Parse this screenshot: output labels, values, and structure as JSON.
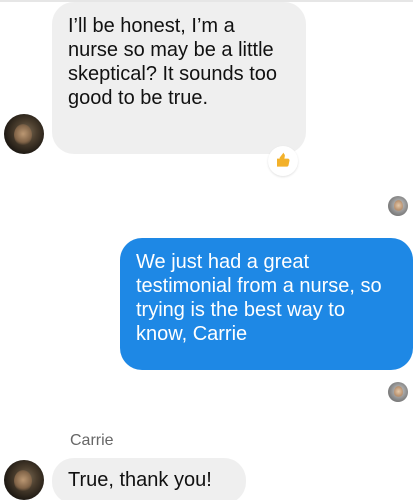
{
  "conversation": {
    "messages": [
      {
        "direction": "incoming",
        "text": "I’ll be honest, I’m a nurse so may be a little skeptical? It sounds too good to be true.",
        "reaction": "thumbs-up-icon"
      },
      {
        "direction": "outgoing",
        "text": "We just had a great testimonial from a nurse, so trying is the best way to know, Carrie"
      },
      {
        "direction": "incoming",
        "sender": "Carrie",
        "text": "True, thank you!"
      }
    ]
  },
  "colors": {
    "incoming_bubble": "#efefef",
    "outgoing_bubble": "#1e88e5",
    "name": "#666666",
    "reaction": "#f3b12a"
  }
}
